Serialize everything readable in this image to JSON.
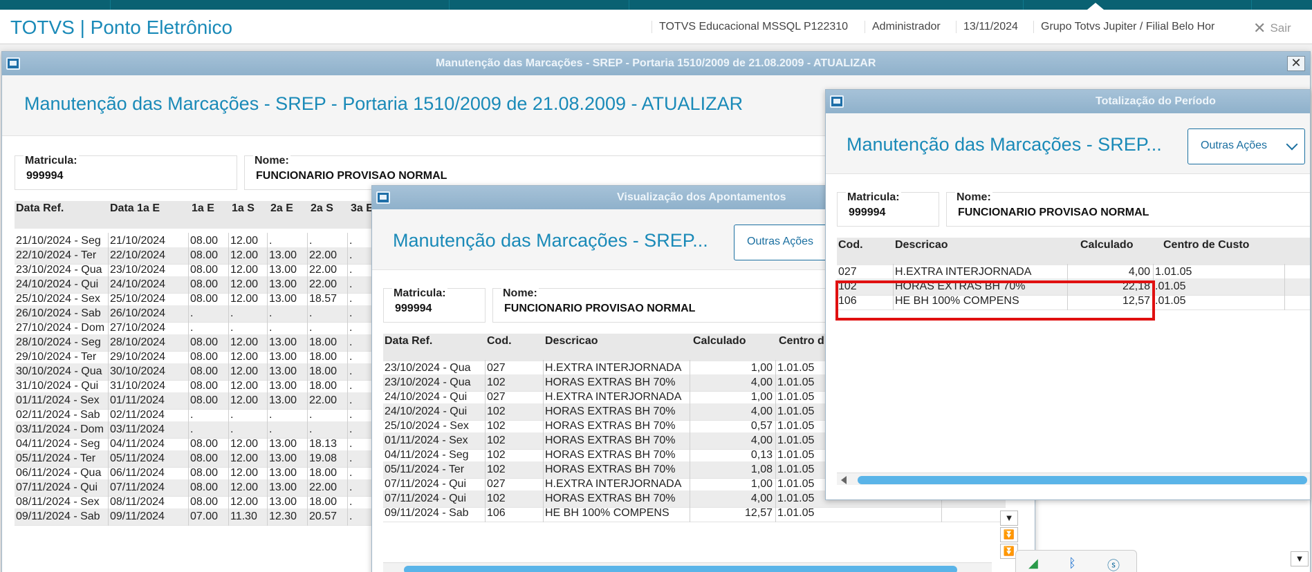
{
  "app": {
    "title": "TOTVS | Ponto Eletrônico",
    "env": "TOTVS Educacional MSSQL P122310",
    "user": "Administrador",
    "date": "13/11/2024",
    "branch": "Grupo Totvs Jupiter / Filial Belo Hor",
    "exit_label": "Sair"
  },
  "main_window": {
    "title": "Manutenção das Marcações - SREP - Portaria 1510/2009 de 21.08.2009 - ATUALIZAR",
    "heading": "Manutenção das Marcações - SREP - Portaria 1510/2009 de 21.08.2009 - ATUALIZAR",
    "close": "✕",
    "matricula_label": "Matricula:",
    "matricula": "999994",
    "nome_label": "Nome:",
    "nome": "FUNCIONARIO PROVISAO NORMAL",
    "columns": [
      "Data Ref.",
      "Data 1a E",
      "1a E",
      "1a S",
      "2a E",
      "2a S",
      "3a E"
    ],
    "rows": [
      [
        "21/10/2024 - Seg",
        "21/10/2024",
        "08.00",
        "12.00",
        ".",
        ".",
        "."
      ],
      [
        "22/10/2024 - Ter",
        "22/10/2024",
        "08.00",
        "12.00",
        "13.00",
        "22.00",
        "."
      ],
      [
        "23/10/2024 - Qua",
        "23/10/2024",
        "08.00",
        "12.00",
        "13.00",
        "22.00",
        "."
      ],
      [
        "24/10/2024 - Qui",
        "24/10/2024",
        "08.00",
        "12.00",
        "13.00",
        "22.00",
        "."
      ],
      [
        "25/10/2024 - Sex",
        "25/10/2024",
        "08.00",
        "12.00",
        "13.00",
        "18.57",
        "."
      ],
      [
        "26/10/2024 - Sab",
        "26/10/2024",
        ".",
        ".",
        ".",
        ".",
        "."
      ],
      [
        "27/10/2024 - Dom",
        "27/10/2024",
        ".",
        ".",
        ".",
        ".",
        "."
      ],
      [
        "28/10/2024 - Seg",
        "28/10/2024",
        "08.00",
        "12.00",
        "13.00",
        "18.00",
        "."
      ],
      [
        "29/10/2024 - Ter",
        "29/10/2024",
        "08.00",
        "12.00",
        "13.00",
        "18.00",
        "."
      ],
      [
        "30/10/2024 - Qua",
        "30/10/2024",
        "08.00",
        "12.00",
        "13.00",
        "18.00",
        "."
      ],
      [
        "31/10/2024 - Qui",
        "31/10/2024",
        "08.00",
        "12.00",
        "13.00",
        "18.00",
        "."
      ],
      [
        "01/11/2024 - Sex",
        "01/11/2024",
        "08.00",
        "12.00",
        "13.00",
        "22.00",
        "."
      ],
      [
        "02/11/2024 - Sab",
        "02/11/2024",
        ".",
        ".",
        ".",
        ".",
        "."
      ],
      [
        "03/11/2024 - Dom",
        "03/11/2024",
        ".",
        ".",
        ".",
        ".",
        "."
      ],
      [
        "04/11/2024 - Seg",
        "04/11/2024",
        "08.00",
        "12.00",
        "13.00",
        "18.13",
        "."
      ],
      [
        "05/11/2024 - Ter",
        "05/11/2024",
        "08.00",
        "12.00",
        "13.00",
        "19.08",
        "."
      ],
      [
        "06/11/2024 - Qua",
        "06/11/2024",
        "08.00",
        "12.00",
        "13.00",
        "18.00",
        "."
      ],
      [
        "07/11/2024 - Qui",
        "07/11/2024",
        "08.00",
        "12.00",
        "13.00",
        "22.00",
        "."
      ],
      [
        "08/11/2024 - Sex",
        "08/11/2024",
        "08.00",
        "12.00",
        "13.00",
        "18.00",
        "."
      ],
      [
        "09/11/2024 - Sab",
        "09/11/2024",
        "07.00",
        "11.30",
        "12.30",
        "20.57",
        "."
      ]
    ]
  },
  "mid_window": {
    "title": "Visualização dos Apontamentos",
    "heading": "Manutenção das Marcações - SREP...",
    "actions_label": "Outras Ações",
    "matricula_label": "Matricula:",
    "matricula": "999994",
    "nome_label": "Nome:",
    "nome": "FUNCIONARIO PROVISAO NORMAL",
    "columns": [
      "Data Ref.",
      "Cod.",
      "Descricao",
      "Calculado",
      "Centro d"
    ],
    "rows": [
      [
        "23/10/2024 - Qua",
        "027",
        "H.EXTRA INTERJORNADA",
        "1,00",
        "1.01.05"
      ],
      [
        "23/10/2024 - Qua",
        "102",
        "HORAS EXTRAS BH 70%",
        "4,00",
        "1.01.05"
      ],
      [
        "24/10/2024 - Qui",
        "027",
        "H.EXTRA INTERJORNADA",
        "1,00",
        "1.01.05"
      ],
      [
        "24/10/2024 - Qui",
        "102",
        "HORAS EXTRAS BH 70%",
        "4,00",
        "1.01.05"
      ],
      [
        "25/10/2024 - Sex",
        "102",
        "HORAS EXTRAS BH 70%",
        "0,57",
        "1.01.05"
      ],
      [
        "01/11/2024 - Sex",
        "102",
        "HORAS EXTRAS BH 70%",
        "4,00",
        "1.01.05"
      ],
      [
        "04/11/2024 - Seg",
        "102",
        "HORAS EXTRAS BH 70%",
        "0,13",
        "1.01.05"
      ],
      [
        "05/11/2024 - Ter",
        "102",
        "HORAS EXTRAS BH 70%",
        "1,08",
        "1.01.05"
      ],
      [
        "07/11/2024 - Qui",
        "027",
        "H.EXTRA INTERJORNADA",
        "1,00",
        "1.01.05"
      ],
      [
        "07/11/2024 - Qui",
        "102",
        "HORAS EXTRAS BH 70%",
        "4,00",
        "1.01.05"
      ],
      [
        "09/11/2024 - Sab",
        "106",
        "HE BH 100% COMPENS",
        "12,57",
        "1.01.05"
      ]
    ]
  },
  "right_window": {
    "title": "Totalização do Período",
    "heading": "Manutenção das Marcações - SREP...",
    "actions_label": "Outras Ações",
    "matricula_label": "Matricula:",
    "matricula": "999994",
    "nome_label": "Nome:",
    "nome": "FUNCIONARIO PROVISAO NORMAL",
    "columns": [
      "Cod.",
      "Descricao",
      "Calculado",
      "Centro de Custo"
    ],
    "rows": [
      [
        "027",
        "H.EXTRA INTERJORNADA",
        "4,00",
        "1.01.05"
      ],
      [
        "102",
        "HORAS EXTRAS BH 70%",
        "22,18",
        ".01.05"
      ],
      [
        "106",
        "HE BH 100% COMPENS",
        "12,57",
        ".01.05"
      ]
    ]
  },
  "colors": {
    "accent": "#1a8ab8",
    "titlebar": "#9ab9d1",
    "highlight": "#e01010",
    "scroll": "#5ab4e8"
  },
  "icons": [
    "window-icon",
    "close-icon",
    "chevron-down-icon",
    "scroll-down-icon"
  ]
}
